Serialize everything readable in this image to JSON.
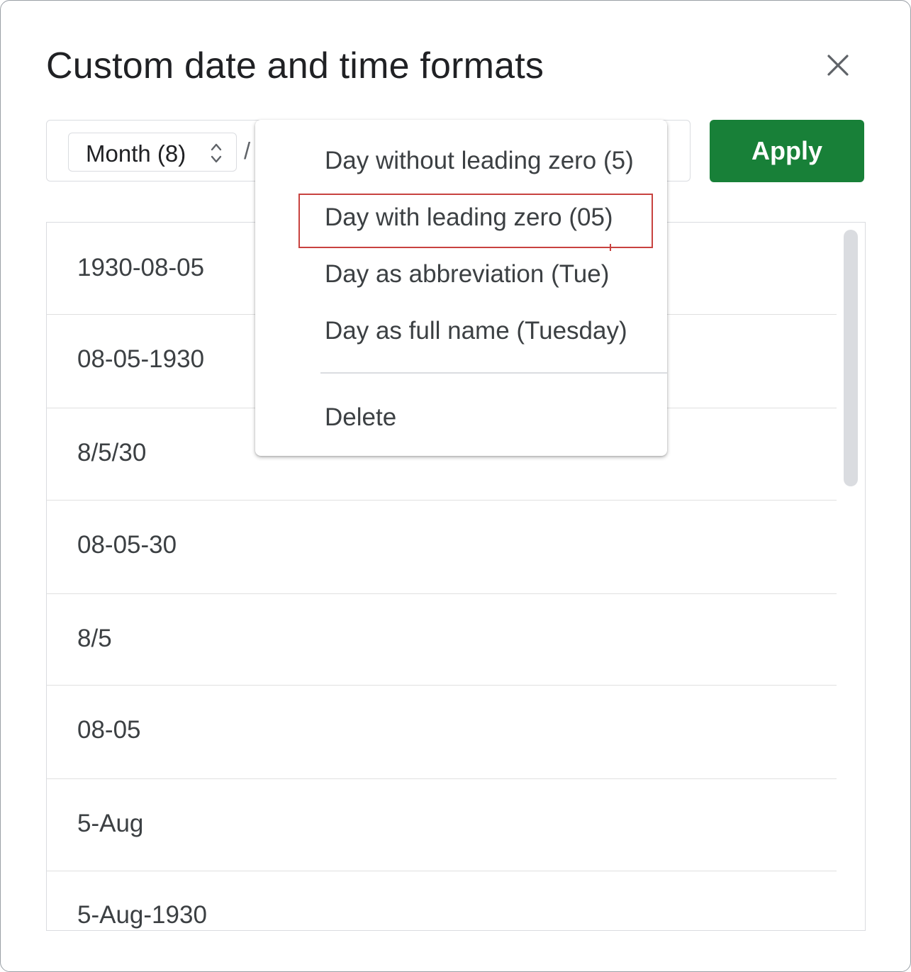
{
  "dialog": {
    "title": "Custom date and time formats"
  },
  "format_bar": {
    "chip_label": "Month (8)",
    "separator": "/"
  },
  "apply_label": "Apply",
  "format_list": [
    "1930-08-05",
    "08-05-1930",
    "8/5/30",
    "08-05-30",
    "8/5",
    "08-05",
    "5-Aug",
    "5-Aug-1930"
  ],
  "menu": {
    "items": [
      "Day without leading zero (5)",
      "Day with leading zero (05)",
      "Day as abbreviation (Tue)",
      "Day as full name (Tuesday)"
    ],
    "delete_label": "Delete",
    "highlighted_index": 1
  },
  "colors": {
    "apply_background": "#188038",
    "highlight_border": "#c8423f"
  },
  "icons": {
    "close": "close-icon",
    "chip_arrows": "unfold-icon"
  }
}
